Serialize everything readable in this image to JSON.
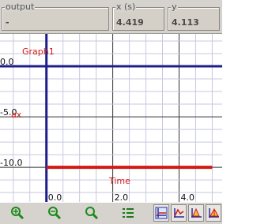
{
  "readout": {
    "output": {
      "legend": "output",
      "value": "-"
    },
    "x": {
      "legend": "x (s)",
      "value": "4.419"
    },
    "y": {
      "legend": "y",
      "value": "4.113"
    }
  },
  "graph": {
    "title": "Graph1",
    "y_axis_label": "ax",
    "x_axis_label": "Time",
    "x_ticks": [
      "0.0",
      "2.0",
      "4.0"
    ],
    "y_ticks": [
      "0.0",
      "-5.0",
      "-10.0"
    ]
  },
  "chart_data": {
    "type": "line",
    "title": "Graph1",
    "xlabel": "Time",
    "ylabel": "ax",
    "xlim": [
      -1.4,
      5.3
    ],
    "ylim": [
      -13.5,
      3.2
    ],
    "grid": true,
    "x_ticks": [
      0.0,
      2.0,
      4.0
    ],
    "y_ticks": [
      0.0,
      -5.0,
      -10.0
    ],
    "series": [
      {
        "x": [
          0.0,
          5.0
        ],
        "y": [
          -10.0,
          -10.0
        ],
        "color": "#d21a14"
      }
    ]
  },
  "colors": {
    "axis": "#1f1f8c",
    "grid_minor": "#c8c8e0",
    "grid_major": "#333333",
    "series": "#d21a14",
    "label_red": "#d21a14",
    "panel": "#d6d3ce"
  },
  "toolbar": {
    "buttons": [
      {
        "icon": "zoom-in-icon"
      },
      {
        "icon": "zoom-out-icon"
      },
      {
        "icon": "zoom-fit-icon"
      },
      {
        "icon": "list-options-icon"
      },
      {
        "icon": "graph-view-1-icon"
      },
      {
        "icon": "graph-view-2-icon"
      },
      {
        "icon": "graph-view-3-icon"
      },
      {
        "icon": "graph-view-4-icon"
      }
    ]
  }
}
